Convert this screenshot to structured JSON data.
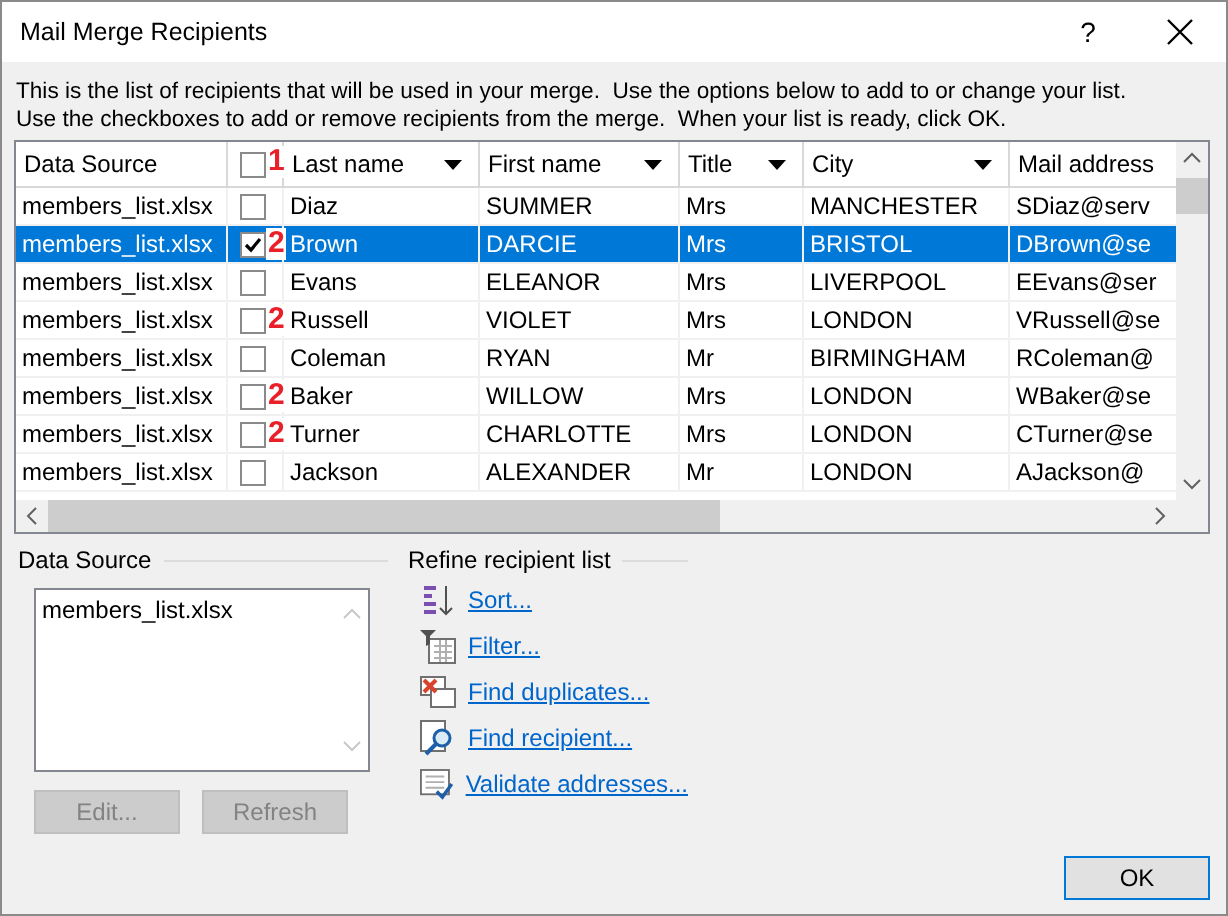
{
  "window": {
    "title": "Mail Merge Recipients",
    "help": "?"
  },
  "intro": "This is the list of recipients that will be used in your merge.  Use the options below to add to or change your list.\nUse the checkboxes to add or remove recipients from the merge.  When your list is ready, click OK.",
  "table": {
    "header_checkbox": {
      "checked": false,
      "annotation": "1"
    },
    "columns": [
      {
        "label": "Data Source",
        "dropdown": false
      },
      {
        "label": "Last name",
        "dropdown": true
      },
      {
        "label": "First name",
        "dropdown": true
      },
      {
        "label": "Title",
        "dropdown": true
      },
      {
        "label": "City",
        "dropdown": true
      },
      {
        "label": "Mail address",
        "dropdown": false
      }
    ],
    "rows": [
      {
        "source": "members_list.xlsx",
        "checked": false,
        "selected": false,
        "last": "Diaz",
        "first": "SUMMER",
        "title": "Mrs",
        "city": "MANCHESTER",
        "mail": "SDiaz@serv"
      },
      {
        "source": "members_list.xlsx",
        "checked": true,
        "selected": true,
        "annotation": "2",
        "last": "Brown",
        "first": "DARCIE",
        "title": "Mrs",
        "city": "BRISTOL",
        "mail": "DBrown@se"
      },
      {
        "source": "members_list.xlsx",
        "checked": false,
        "selected": false,
        "last": "Evans",
        "first": "ELEANOR",
        "title": "Mrs",
        "city": "LIVERPOOL",
        "mail": "EEvans@ser"
      },
      {
        "source": "members_list.xlsx",
        "checked": false,
        "selected": false,
        "annotation": "2",
        "last": "Russell",
        "first": "VIOLET",
        "title": "Mrs",
        "city": "LONDON",
        "mail": "VRussell@se"
      },
      {
        "source": "members_list.xlsx",
        "checked": false,
        "selected": false,
        "last": "Coleman",
        "first": "RYAN",
        "title": "Mr",
        "city": "BIRMINGHAM",
        "mail": "RColeman@"
      },
      {
        "source": "members_list.xlsx",
        "checked": false,
        "selected": false,
        "annotation": "2",
        "last": "Baker",
        "first": "WILLOW",
        "title": "Mrs",
        "city": "LONDON",
        "mail": "WBaker@se"
      },
      {
        "source": "members_list.xlsx",
        "checked": false,
        "selected": false,
        "annotation": "2",
        "last": "Turner",
        "first": "CHARLOTTE",
        "title": "Mrs",
        "city": "LONDON",
        "mail": "CTurner@se"
      },
      {
        "source": "members_list.xlsx",
        "checked": false,
        "selected": false,
        "last": "Jackson",
        "first": "ALEXANDER",
        "title": "Mr",
        "city": "LONDON",
        "mail": "AJackson@"
      }
    ]
  },
  "data_source": {
    "label": "Data Source",
    "items": [
      "members_list.xlsx"
    ],
    "buttons": [
      {
        "label": "Edit...",
        "disabled": true
      },
      {
        "label": "Refresh",
        "disabled": true
      }
    ]
  },
  "refine": {
    "label": "Refine recipient list",
    "links": [
      {
        "kind": "sort",
        "label": "Sort..."
      },
      {
        "kind": "filter",
        "label": "Filter..."
      },
      {
        "kind": "duplicates",
        "label": "Find duplicates..."
      },
      {
        "kind": "find",
        "label": "Find recipient..."
      },
      {
        "kind": "validate",
        "label": "Validate addresses..."
      }
    ]
  },
  "ok_button": "OK"
}
